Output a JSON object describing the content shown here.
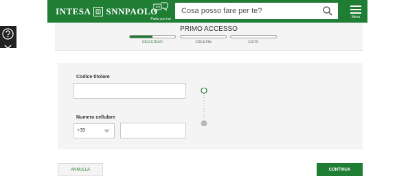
{
  "header": {
    "logo_left": "INTESA",
    "logo_right": "SNNPAOLO",
    "chat_label": "Parla con noi",
    "search_placeholder": "Cosa posso fare per te?",
    "menu_label": "Menu"
  },
  "steps": {
    "title": "PRIMO ACCESSO",
    "items": [
      {
        "label": "REGISTRATI",
        "progress": 0.5
      },
      {
        "label": "CREA PIN",
        "progress": 0
      },
      {
        "label": "ESITO",
        "progress": 0
      }
    ]
  },
  "form": {
    "code_label": "Codice titolare",
    "code_value": "",
    "phone_label": "Numero cellulare",
    "phone_prefix": "+39",
    "phone_value": ""
  },
  "actions": {
    "cancel_label": "ANNULLA",
    "continue_label": "CONTINUA"
  },
  "colors": {
    "brand_green": "#1f7d34",
    "panel_gray": "#f4f4f4"
  },
  "icons": {
    "help": "help-icon",
    "chat": "chat-icon",
    "search": "search-icon",
    "menu": "menu-icon",
    "prefix": "chevron-down-icon"
  }
}
